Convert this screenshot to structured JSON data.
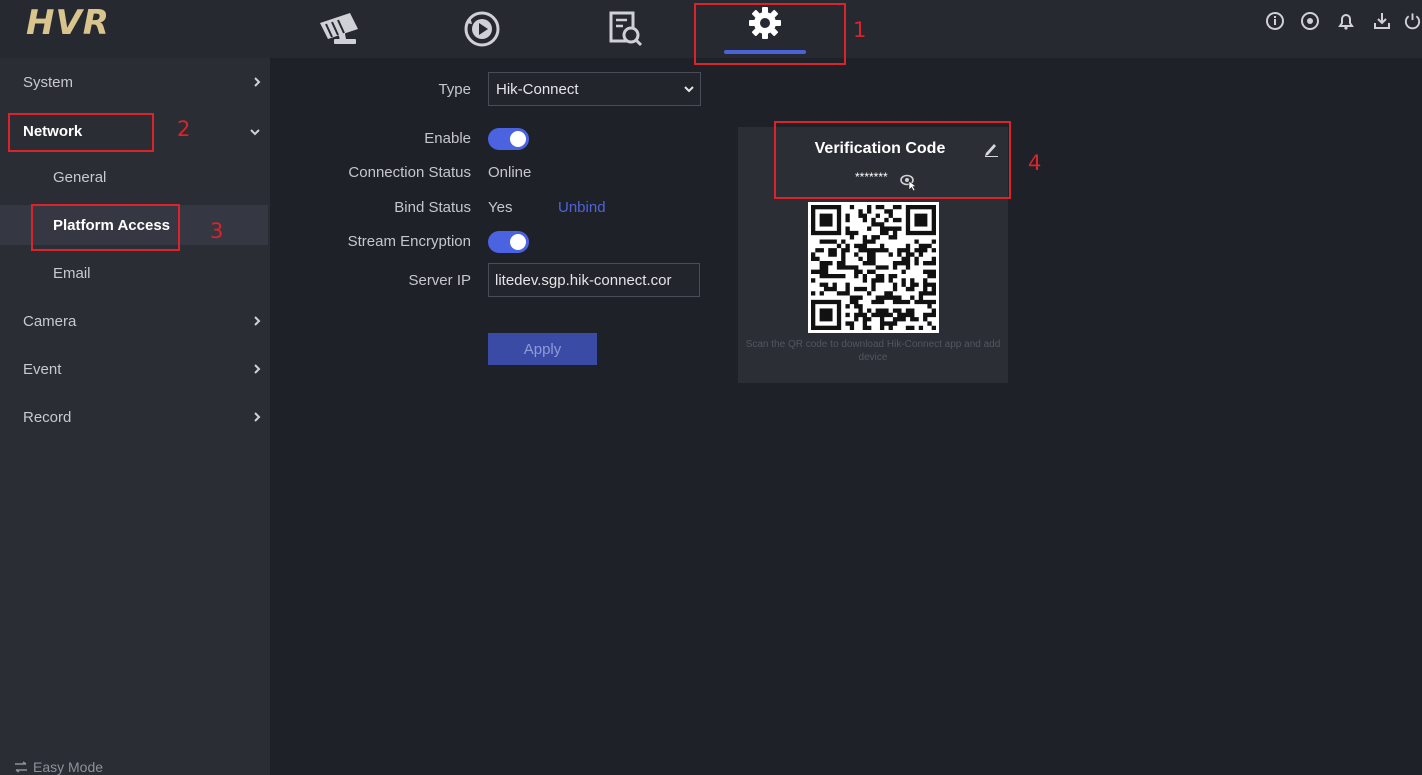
{
  "app": {
    "logo": "HVR"
  },
  "topnav": [
    {
      "name": "live-view",
      "icon": "camera-icon"
    },
    {
      "name": "playback",
      "icon": "playback-icon"
    },
    {
      "name": "search",
      "icon": "file-search-icon"
    },
    {
      "name": "configuration",
      "icon": "gear-icon",
      "active": true
    }
  ],
  "topright_icons": [
    "info-icon",
    "record-status-icon",
    "alarm-bell-icon",
    "download-icon",
    "power-icon"
  ],
  "sidebar": {
    "items": [
      {
        "label": "System",
        "expanded": false
      },
      {
        "label": "Network",
        "expanded": true
      },
      {
        "label": "Camera",
        "expanded": false
      },
      {
        "label": "Event",
        "expanded": false
      },
      {
        "label": "Record",
        "expanded": false
      }
    ],
    "network_subitems": [
      {
        "label": "General"
      },
      {
        "label": "Platform Access",
        "selected": true
      },
      {
        "label": "Email"
      }
    ],
    "easy_mode": "Easy Mode"
  },
  "form": {
    "type_label": "Type",
    "type_value": "Hik-Connect",
    "enable_label": "Enable",
    "enable_on": true,
    "connection_status_label": "Connection Status",
    "connection_status_value": "Online",
    "bind_status_label": "Bind Status",
    "bind_status_value": "Yes",
    "unbind_label": "Unbind",
    "stream_encryption_label": "Stream Encryption",
    "stream_encryption_on": true,
    "server_ip_label": "Server IP",
    "server_ip_value": "litedev.sgp.hik-connect.cor",
    "apply_label": "Apply"
  },
  "verification": {
    "title": "Verification Code",
    "masked_code": "*******",
    "caption": "Scan the QR code to download Hik-Connect app and add device"
  },
  "annotations": [
    "1",
    "2",
    "3",
    "4"
  ],
  "colors": {
    "accent": "#4b63e0",
    "annotation": "#d8242a",
    "logo": "#d9c48d"
  }
}
